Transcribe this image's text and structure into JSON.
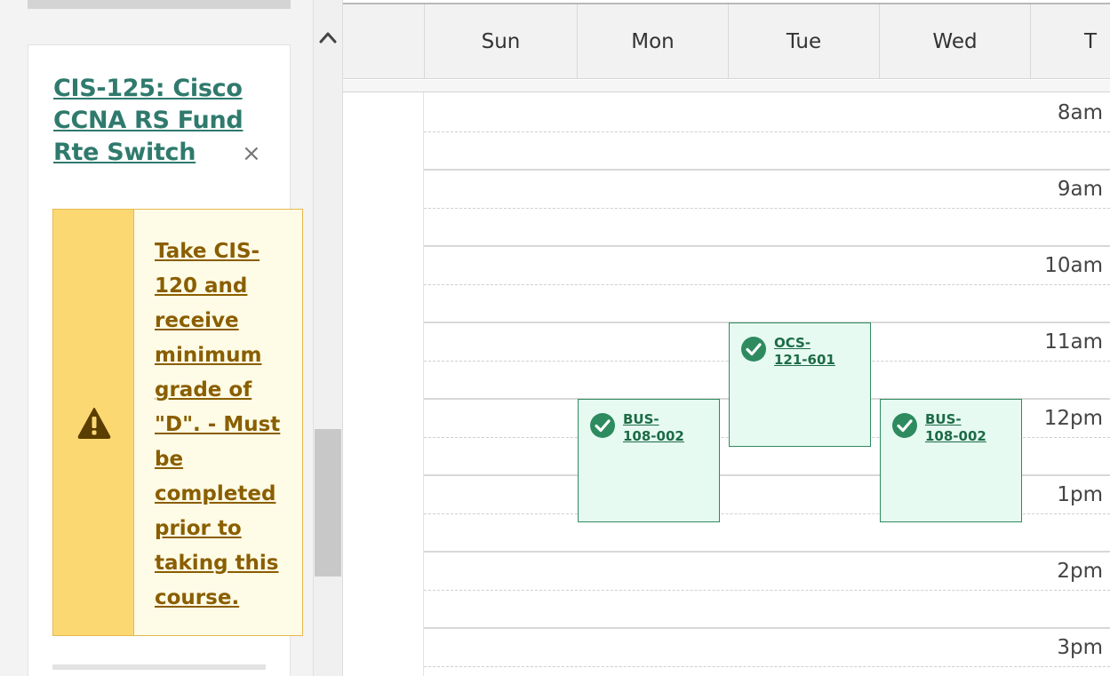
{
  "course": {
    "title": "CIS-125: Cisco CCNA RS Fund Rte Switch",
    "close_symbol": "×",
    "prerequisite_warning": "Take CIS-120 and receive minimum grade of \"D\". - Must be completed prior to taking this course.",
    "warning_icon": "warning-triangle-icon"
  },
  "calendar": {
    "days": [
      "Sun",
      "Mon",
      "Tue",
      "Wed",
      "T"
    ],
    "times": [
      "8am",
      "9am",
      "10am",
      "11am",
      "12pm",
      "1pm",
      "2pm",
      "3pm"
    ],
    "events": [
      {
        "label": "BUS-108-002",
        "day": "Mon",
        "start": "12pm",
        "status": "check-circle-icon"
      },
      {
        "label": "OCS-121-601",
        "day": "Tue",
        "start": "11am",
        "status": "check-circle-icon"
      },
      {
        "label": "BUS-108-002",
        "day": "Wed",
        "start": "12pm",
        "status": "check-circle-icon"
      }
    ]
  },
  "colors": {
    "course_link": "#2f7a6d",
    "warning_bg": "#fefce6",
    "warning_stripe": "#fcd873",
    "warning_text": "#8a5e00",
    "event_bg": "#e6faf2",
    "event_border": "#2e8b5f"
  }
}
